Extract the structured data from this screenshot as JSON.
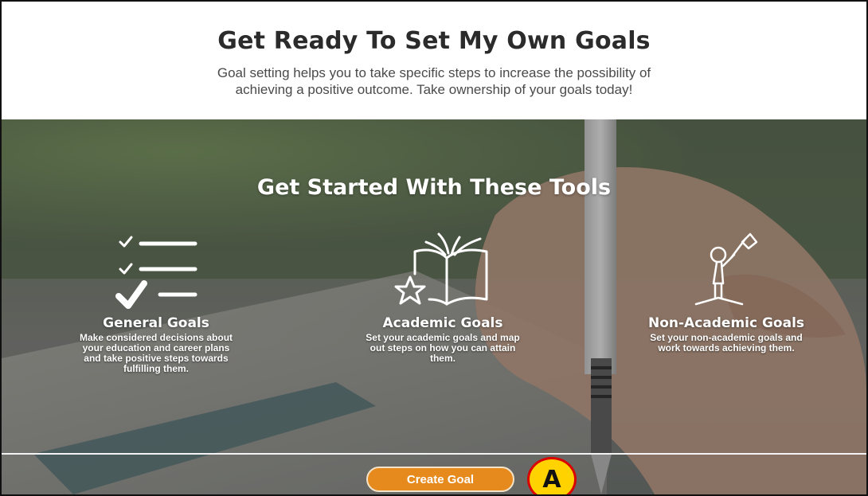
{
  "header": {
    "title": "Get Ready To Set My Own Goals",
    "subtitle_line1": "Goal setting helps you to take specific steps to increase the possibility of",
    "subtitle_line2": "achieving a positive outcome. Take ownership of your goals today!"
  },
  "hero": {
    "heading": "Get Started With These Tools",
    "tools": [
      {
        "icon": "checklist-icon",
        "name": "General Goals",
        "desc_lines": [
          "Make considered decisions about",
          "your education and career plans",
          "and take positive steps towards",
          "fulfilling them."
        ]
      },
      {
        "icon": "book-star-icon",
        "name": "Academic Goals",
        "desc_lines": [
          "Set your academic goals and map",
          "out steps on how you can attain",
          "them."
        ]
      },
      {
        "icon": "summit-flag-icon",
        "name": "Non-Academic Goals",
        "desc_lines": [
          "Set your non-academic goals and",
          "work towards achieving them."
        ]
      }
    ],
    "button_label": "Create Goal",
    "callout_label": "A"
  },
  "colors": {
    "button": "#e78a1d",
    "callout_fill": "#ffd200",
    "callout_border": "#d80000",
    "title_text": "#2b2b2b"
  }
}
